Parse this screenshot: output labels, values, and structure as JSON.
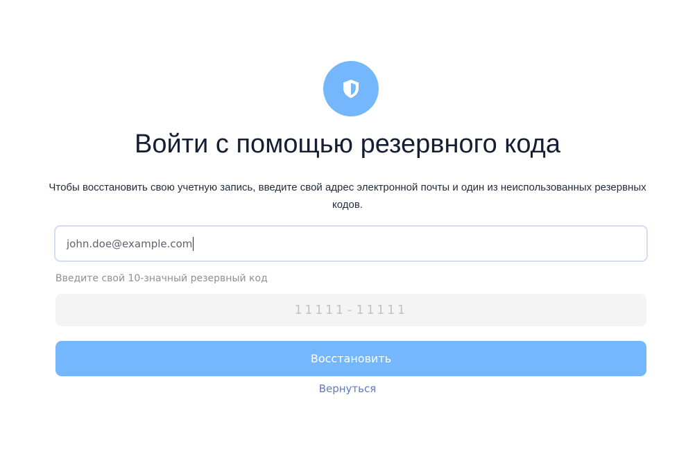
{
  "header": {
    "icon": "shield-icon",
    "title": "Войти с помощью резервного кода",
    "subtitle": "Чтобы восстановить свою учетную запись, введите свой адрес электронной почты и один из неиспользованных резервных кодов."
  },
  "form": {
    "email_value": "john.doe@example.com",
    "code_label": "Введите свой 10-значный резервный код",
    "code_placeholder": "11111-11111",
    "submit_label": "Восстановить",
    "back_label": "Вернуться"
  },
  "colors": {
    "accent": "#74b7fd",
    "link": "#5d7bc2",
    "title": "#161e34",
    "field_bg": "#f4f4f4",
    "field_border": "#d2ddf1"
  }
}
